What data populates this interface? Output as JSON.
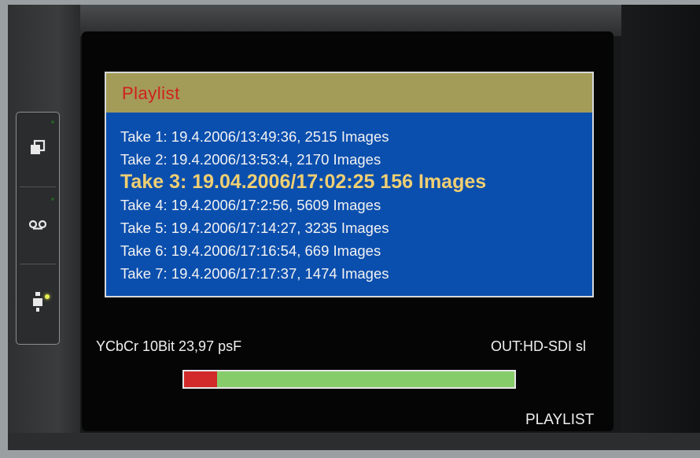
{
  "playlist": {
    "title": "Playlist",
    "takes": [
      "Take 1: 19.4.2006/13:49:36, 2515 Images",
      "Take 2: 19.4.2006/13:53:4, 2170 Images",
      "Take 3: 19.04.2006/17:02:25 156 Images",
      "Take 4: 19.4.2006/17:2:56, 5609 Images",
      "Take 5: 19.4.2006/17:14:27, 3235 Images",
      "Take 6: 19.4.2006/17:16:54, 669 Images",
      "Take 7: 19.4.2006/17:17:37, 1474 Images"
    ],
    "selected_index": 2
  },
  "status": {
    "format": "YCbCr 10Bit 23,97 psF",
    "output": "OUT:HD-SDI sl",
    "mode": "PLAYLIST",
    "progress_fraction": 0.1
  },
  "colors": {
    "header_bg": "#a39b58",
    "title_red": "#d0201e",
    "list_bg": "#0b4fae",
    "selected_text": "#f0cf72",
    "progress_fill": "#d22a2a",
    "progress_track": "#86cc6a"
  },
  "side_buttons": {
    "icons": [
      "copy-icon",
      "tape-icon",
      "usb-icon"
    ]
  }
}
